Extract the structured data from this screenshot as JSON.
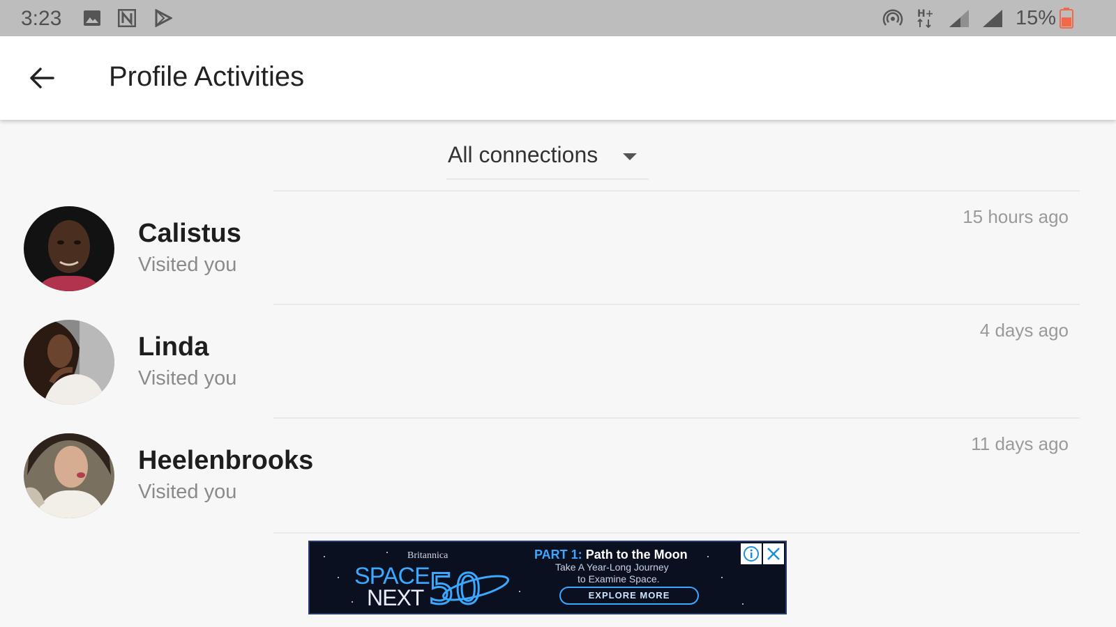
{
  "status_bar": {
    "time": "3:23",
    "battery_text": "15%",
    "icons": [
      "gallery-icon",
      "news-icon",
      "play-store-icon",
      "hotspot-icon",
      "h-plus-data-icon",
      "signal-icon",
      "signal-icon",
      "battery-low-icon"
    ],
    "battery_color": "#f06a4a"
  },
  "app_bar": {
    "title": "Profile Activities",
    "back_icon": "arrow-back-icon"
  },
  "filter": {
    "selected": "All connections",
    "icon": "caret-down-icon"
  },
  "activities": [
    {
      "name": "Calistus",
      "action": "Visited you",
      "time": "15 hours ago"
    },
    {
      "name": "Linda",
      "action": "Visited you",
      "time": "4 days ago"
    },
    {
      "name": "Heelenbrooks",
      "action": "Visited you",
      "time": "11 days ago"
    }
  ],
  "ad": {
    "brand": "Britannica",
    "space": "SPACE",
    "next": "NEXT",
    "fifty": "50",
    "part": "PART 1:",
    "headline": "Path to the Moon",
    "sub1": "Take A Year-Long Journey",
    "sub2": "to Examine Space.",
    "cta": "EXPLORE MORE",
    "accent": "#3aa8ff"
  }
}
